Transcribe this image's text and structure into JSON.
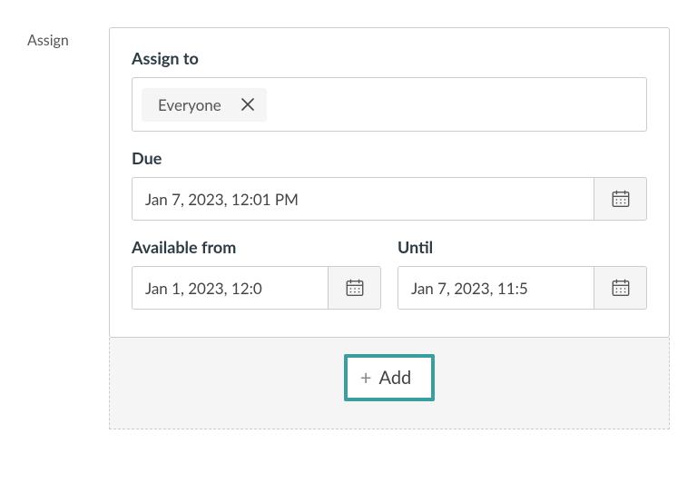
{
  "sideLabel": "Assign",
  "assignTo": {
    "label": "Assign to",
    "tokens": [
      {
        "label": "Everyone"
      }
    ]
  },
  "due": {
    "label": "Due",
    "value": "Jan 7, 2023, 12:01 PM"
  },
  "availableFrom": {
    "label": "Available from",
    "value": "Jan 1, 2023, 12:0"
  },
  "until": {
    "label": "Until",
    "value": "Jan 7, 2023, 11:5"
  },
  "addButton": {
    "label": "Add"
  },
  "icons": {
    "close": "close-icon",
    "calendar": "calendar-icon",
    "plus": "plus-icon"
  }
}
